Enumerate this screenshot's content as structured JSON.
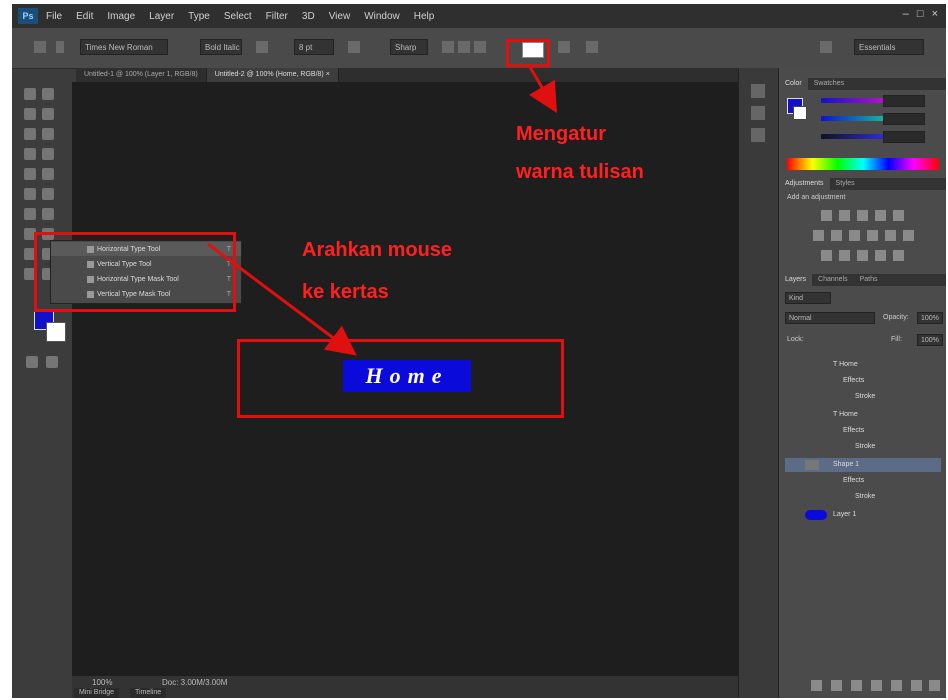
{
  "app": {
    "logo": "Ps",
    "menu": [
      "File",
      "Edit",
      "Image",
      "Layer",
      "Type",
      "Select",
      "Filter",
      "3D",
      "View",
      "Window",
      "Help"
    ],
    "window_controls": [
      "–",
      "□",
      "×"
    ]
  },
  "options_bar": {
    "font_family": "Times New Roman",
    "font_style": "Bold Italic",
    "font_size": "8 pt",
    "antialias": "Sharp",
    "workspace": "Essentials",
    "text_color": "#ffffff"
  },
  "doc_tabs": [
    {
      "label": "Untitled-1 @ 100% (Layer 1, RGB/8)",
      "active": false
    },
    {
      "label": "Untitled-2 @ 100% (Home, RGB/8) ×",
      "active": true
    }
  ],
  "type_tool_flyout": {
    "items": [
      {
        "label": "Horizontal Type Tool",
        "key": "T"
      },
      {
        "label": "Vertical Type Tool",
        "key": "T"
      },
      {
        "label": "Horizontal Type Mask Tool",
        "key": "T"
      },
      {
        "label": "Vertical Type Mask Tool",
        "key": "T"
      }
    ]
  },
  "canvas": {
    "text": "Home",
    "text_bg_color": "#0a0adb",
    "text_color": "#ffffff"
  },
  "annotations": {
    "color_label_line1": "Mengatur",
    "color_label_line2": "warna tulisan",
    "mouse_label_line1": "Arahkan mouse",
    "mouse_label_line2": "ke kertas",
    "annotation_color": "#ff2020"
  },
  "status": {
    "zoom": "100%",
    "doc_info": "Doc: 3.00M/3.00M",
    "tabs": [
      "Mini Bridge",
      "Timeline"
    ]
  },
  "panels": {
    "color_tabs": [
      "Color",
      "Swatches"
    ],
    "adjust_tabs": [
      "Adjustments",
      "Styles"
    ],
    "adjust_title": "Add an adjustment",
    "layer_tabs": [
      "Layers",
      "Channels",
      "Paths"
    ],
    "kind": "Kind",
    "blend_mode": "Normal",
    "opacity_label": "Opacity:",
    "opacity_value": "100%",
    "lock_label": "Lock:",
    "fill_label": "Fill:",
    "fill_value": "100%",
    "layers": [
      {
        "name": "T  Home",
        "kind": "text"
      },
      {
        "name": "Effects",
        "kind": "effect"
      },
      {
        "name": "Stroke",
        "kind": "effect"
      },
      {
        "name": "T  Home",
        "kind": "text"
      },
      {
        "name": "Effects",
        "kind": "effect"
      },
      {
        "name": "Stroke",
        "kind": "effect"
      },
      {
        "name": "Shape 1",
        "kind": "shape",
        "selected": true
      },
      {
        "name": "Effects",
        "kind": "effect"
      },
      {
        "name": "Stroke",
        "kind": "effect"
      },
      {
        "name": "Layer 1",
        "kind": "pixel"
      }
    ],
    "foreground_color": "#1111cc",
    "background_color": "#ffffff"
  }
}
